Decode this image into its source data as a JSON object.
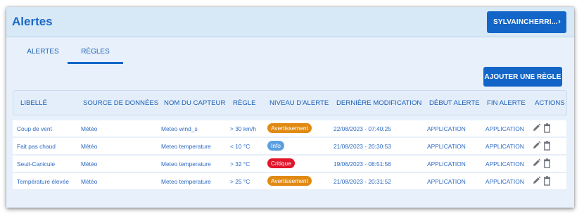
{
  "header": {
    "title": "Alertes",
    "user_label": "SYLVAINCHERRI...",
    "user_chevron": "›"
  },
  "tabs": [
    {
      "label": "ALERTES",
      "active": false
    },
    {
      "label": "RÈGLES",
      "active": true
    }
  ],
  "toolbar": {
    "add_label": "AJOUTER UNE RÈGLE"
  },
  "table": {
    "columns": [
      "LIBELLÉ",
      "SOURCE DE DONNÉES",
      "NOM DU CAPTEUR",
      "RÈGLE",
      "NIVEAU D'ALERTE",
      "DERNIÈRE MODIFICATION",
      "DÉBUT ALERTE",
      "FIN ALERTE",
      "ACTIONS"
    ],
    "rows": [
      {
        "libelle": "Coup de vent",
        "source": "Météo",
        "capteur": "Meteo wind_s",
        "regle": "> 30 km/h",
        "niveau": "Avertissement",
        "niveau_color": "#e08a12",
        "modification": "22/08/2023 - 07:40:25",
        "debut": "APPLICATION",
        "fin": "APPLICATION"
      },
      {
        "libelle": "Fait pas chaud",
        "source": "Météo",
        "capteur": "Meteo temperature",
        "regle": "< 10 °C",
        "niveau": "Info",
        "niveau_color": "#5b9fe0",
        "modification": "21/08/2023 - 20:30:53",
        "debut": "APPLICATION",
        "fin": "APPLICATION"
      },
      {
        "libelle": "Seuil-Canicule",
        "source": "Météo",
        "capteur": "Meteo temperature",
        "regle": "> 32 °C",
        "niveau": "Critique",
        "niveau_color": "#e2142a",
        "modification": "19/06/2023 - 08:51:56",
        "debut": "APPLICATION",
        "fin": "APPLICATION"
      },
      {
        "libelle": "Température élevée",
        "source": "Météo",
        "capteur": "Meteo temperature",
        "regle": "> 25 °C",
        "niveau": "Avertissement",
        "niveau_color": "#e08a12",
        "modification": "21/08/2023 - 20:31:52",
        "debut": "APPLICATION",
        "fin": "APPLICATION"
      }
    ]
  },
  "icons": {
    "edit": "pencil-icon",
    "delete": "trash-icon"
  },
  "colors": {
    "accent": "#1366c8",
    "header_bg": "#d7e8f7",
    "page_bg": "#e8f1fb"
  }
}
